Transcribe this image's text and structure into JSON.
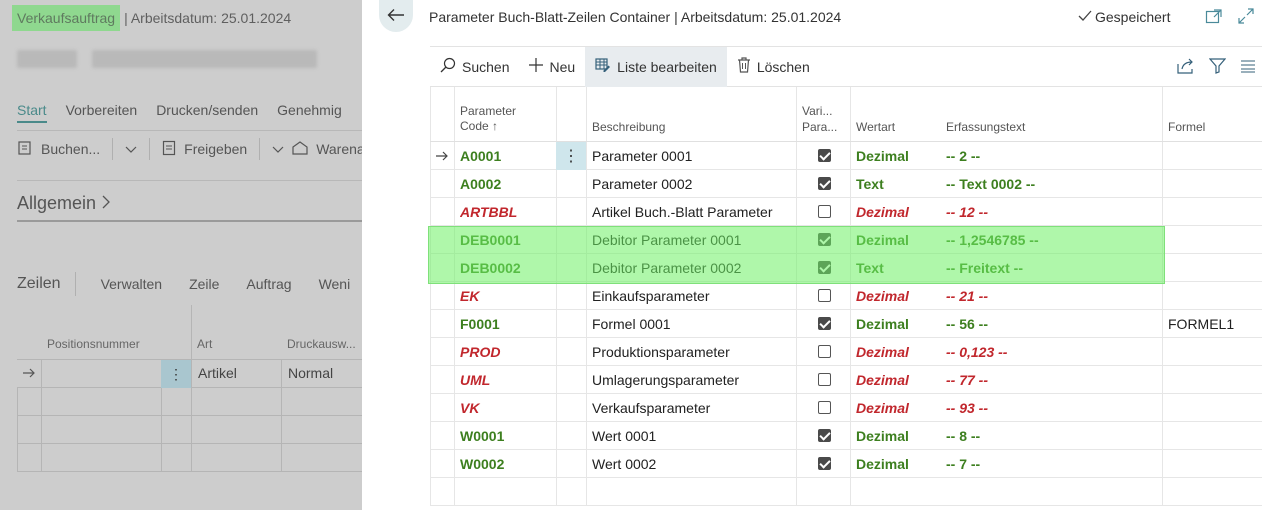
{
  "background": {
    "title_highlight": "Verkaufsauftrag",
    "title_rest": "| Arbeitsdatum: 25.01.2024",
    "tabs": [
      "Start",
      "Vorbereiten",
      "Drucken/senden",
      "Genehmig"
    ],
    "actions": [
      "Buchen...",
      "Freigeben",
      "Warena"
    ],
    "section_title": "Allgemein",
    "lines_title": "Zeilen",
    "lines_actions": [
      "Verwalten",
      "Zeile",
      "Auftrag",
      "Weni"
    ],
    "grid_headers": [
      "Positionsnummer",
      "Art",
      "Druckausw..."
    ],
    "grid_row": {
      "art": "Artikel",
      "druck": "Normal"
    }
  },
  "panel": {
    "title": "Parameter Buch-Blatt-Zeilen Container | Arbeitsdatum: 25.01.2024",
    "saved_label": "Gespeichert",
    "toolbar": {
      "search": "Suchen",
      "new": "Neu",
      "edit_list": "Liste bearbeiten",
      "delete": "Löschen"
    },
    "columns": {
      "code_line1": "Parameter",
      "code_line2": "Code",
      "description": "Beschreibung",
      "variable_line1": "Vari...",
      "variable_line2": "Para...",
      "value_type": "Wertart",
      "entry_text": "Erfassungstext",
      "formula": "Formel"
    },
    "rows": [
      {
        "code": "A0001",
        "desc": "Parameter 0001",
        "checked": true,
        "type": "Dezimal",
        "text": "-- 2 --",
        "formula": "",
        "style": "green"
      },
      {
        "code": "A0002",
        "desc": "Parameter 0002",
        "checked": true,
        "type": "Text",
        "text": "-- Text 0002 --",
        "formula": "",
        "style": "green"
      },
      {
        "code": "ARTBBL",
        "desc": "Artikel Buch.-Blatt Parameter",
        "checked": false,
        "type": "Dezimal",
        "text": "-- 12 --",
        "formula": "",
        "style": "red"
      },
      {
        "code": "DEB0001",
        "desc": "Debitor Parameter 0001",
        "checked": true,
        "type": "Dezimal",
        "text": "-- 1,2546785 --",
        "formula": "",
        "style": "green"
      },
      {
        "code": "DEB0002",
        "desc": "Debitor Parameter 0002",
        "checked": true,
        "type": "Text",
        "text": "-- Freitext --",
        "formula": "",
        "style": "green"
      },
      {
        "code": "EK",
        "desc": "Einkaufsparameter",
        "checked": false,
        "type": "Dezimal",
        "text": "-- 21 --",
        "formula": "",
        "style": "red"
      },
      {
        "code": "F0001",
        "desc": "Formel 0001",
        "checked": true,
        "type": "Dezimal",
        "text": "-- 56 --",
        "formula": "FORMEL1",
        "style": "green"
      },
      {
        "code": "PROD",
        "desc": "Produktionsparameter",
        "checked": false,
        "type": "Dezimal",
        "text": "-- 0,123 --",
        "formula": "",
        "style": "red"
      },
      {
        "code": "UML",
        "desc": "Umlagerungsparameter",
        "checked": false,
        "type": "Dezimal",
        "text": "-- 77 --",
        "formula": "",
        "style": "red"
      },
      {
        "code": "VK",
        "desc": "Verkaufsparameter",
        "checked": false,
        "type": "Dezimal",
        "text": "-- 93 --",
        "formula": "",
        "style": "red"
      },
      {
        "code": "W0001",
        "desc": "Wert 0001",
        "checked": true,
        "type": "Dezimal",
        "text": "-- 8 --",
        "formula": "",
        "style": "green"
      },
      {
        "code": "W0002",
        "desc": "Wert 0002",
        "checked": true,
        "type": "Dezimal",
        "text": "-- 7 --",
        "formula": "",
        "style": "green"
      }
    ]
  },
  "colors": {
    "green_text": "#3d7f1f",
    "red_text": "#c1272d",
    "highlight": "#8ff58a"
  },
  "icons": [
    "back-arrow-icon",
    "checkmark-icon",
    "open-new-window-icon",
    "collapse-icon",
    "search-icon",
    "plus-icon",
    "edit-list-icon",
    "trash-icon",
    "share-icon",
    "filter-icon",
    "list-view-icon",
    "row-arrow-icon",
    "more-dots-icon"
  ]
}
